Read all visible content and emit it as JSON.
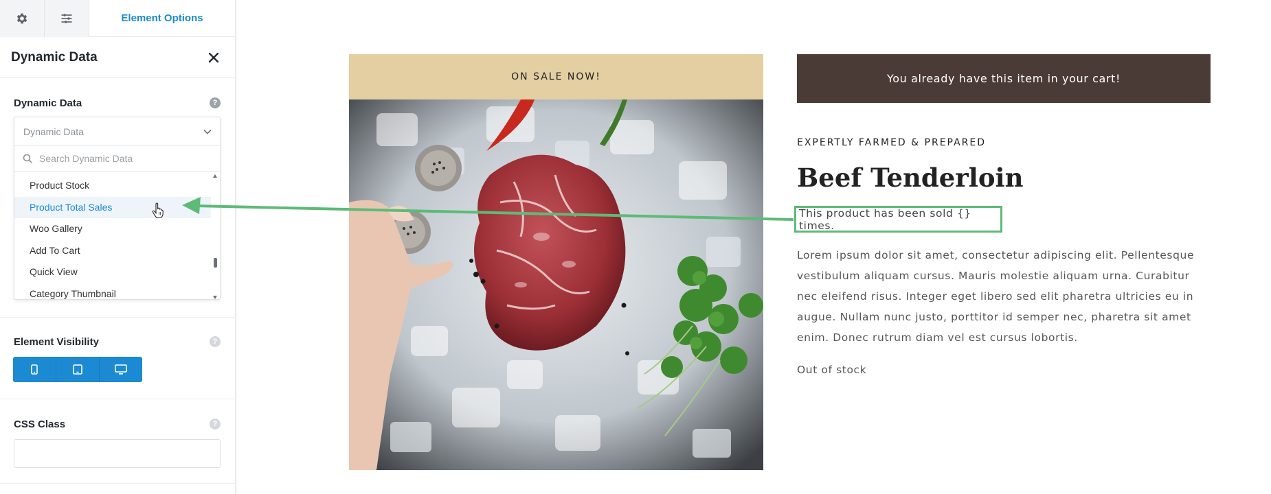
{
  "sidebar": {
    "tabs": [
      {
        "icon": "gear-icon"
      },
      {
        "icon": "sliders-icon"
      },
      {
        "label": "Element Options"
      }
    ],
    "panel_title": "Dynamic Data",
    "dynamic_data": {
      "label": "Dynamic Data",
      "select_value": "Dynamic Data",
      "search_placeholder": "Search Dynamic Data",
      "items": [
        {
          "label": "Product Stock"
        },
        {
          "label": "Product Total Sales",
          "active": true
        },
        {
          "label": "Woo Gallery"
        },
        {
          "label": "Add To Cart"
        },
        {
          "label": "Quick View"
        },
        {
          "label": "Category Thumbnail"
        }
      ]
    },
    "visibility": {
      "label": "Element Visibility",
      "devices": [
        "phone-icon",
        "tablet-icon",
        "desktop-icon"
      ]
    },
    "css_class": {
      "label": "CSS Class",
      "value": ""
    }
  },
  "product": {
    "sale_banner": "ON SALE NOW!",
    "cart_notice": "You already have this item in your cart!",
    "eyebrow": "EXPERTLY FARMED & PREPARED",
    "title": "Beef Tenderloin",
    "sold_text": "This product has been sold {} times.",
    "description": "Lorem ipsum dolor sit amet, consectetur adipiscing elit. Pellentesque vestibulum aliquam cursus. Mauris molestie aliquam urna. Curabitur nec eleifend risus. Integer eget libero sed elit pharetra ultricies eu in augue. Nullam nunc justo, porttitor id semper nec, pharetra sit amet enim. Donec rutrum diam vel est cursus lobortis.",
    "stock": "Out of stock"
  },
  "colors": {
    "accent": "#1b8ad2",
    "annotation": "#5dba77",
    "banner": "#e3cfa1",
    "notice": "#4a3b36"
  }
}
